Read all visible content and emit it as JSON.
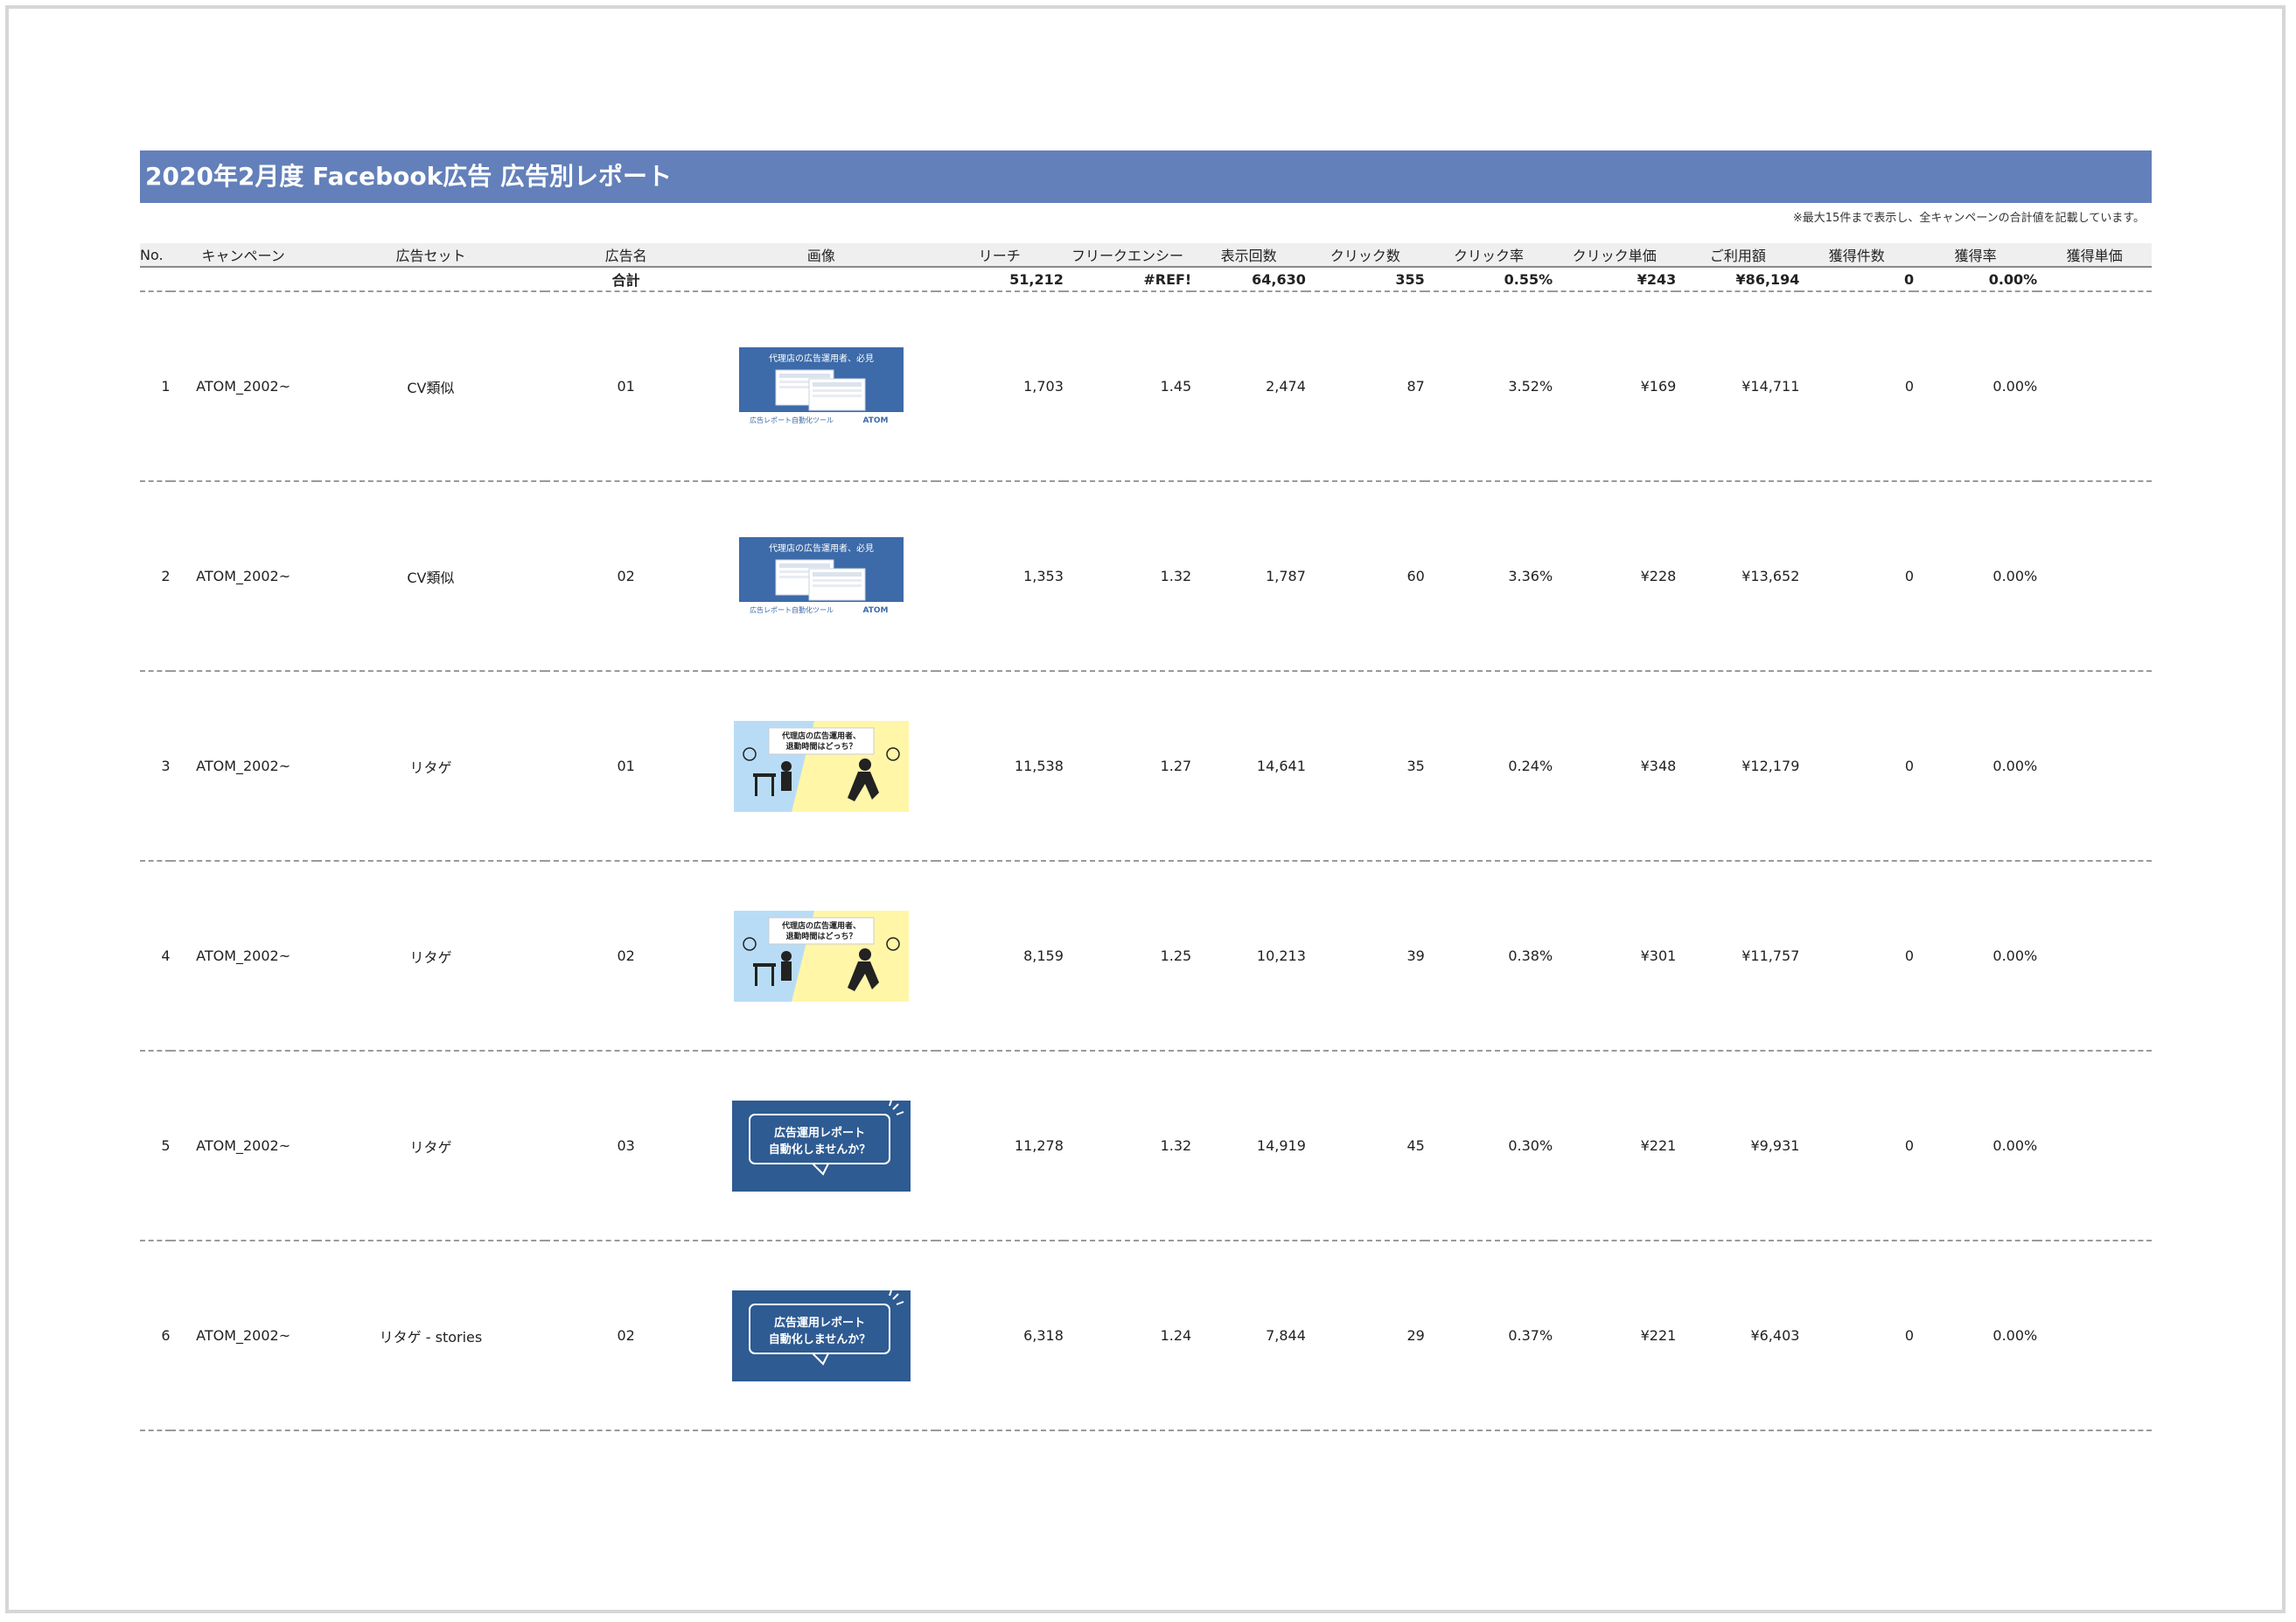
{
  "report": {
    "title": "2020年2月度 Facebook広告 広告別レポート",
    "note": "※最大15件まで表示し、全キャンペーンの合計値を記載しています。"
  },
  "columns": [
    "No.",
    "キャンペーン",
    "広告セット",
    "広告名",
    "画像",
    "リーチ",
    "フリークエンシー",
    "表示回数",
    "クリック数",
    "クリック率",
    "クリック単価",
    "ご利用額",
    "獲得件数",
    "獲得率",
    "獲得単価"
  ],
  "totals": {
    "label": "合計",
    "reach": "51,212",
    "frequency": "#REF!",
    "impressions": "64,630",
    "clicks": "355",
    "ctr": "0.55%",
    "cpc": "¥243",
    "spend": "¥86,194",
    "conversions": "0",
    "cvr": "0.00%",
    "cpa": ""
  },
  "creatives": {
    "banner_a": {
      "line1": "代理店の広告運用者、必見",
      "line2": "広告レポート自動化ツール",
      "brand": "ATOM"
    },
    "banner_b": {
      "line1": "代理店の広告運用者、",
      "line2": "退勤時間はどっち？"
    },
    "banner_c": {
      "line1": "広告運用レポート",
      "line2": "自動化しませんか？"
    }
  },
  "rows": [
    {
      "no": "1",
      "campaign": "ATOM_2002~",
      "adset": "CV類似",
      "ad": "01",
      "image": "banner-a",
      "reach": "1,703",
      "frequency": "1.45",
      "impressions": "2,474",
      "clicks": "87",
      "ctr": "3.52%",
      "cpc": "¥169",
      "spend": "¥14,711",
      "conversions": "0",
      "cvr": "0.00%",
      "cpa": ""
    },
    {
      "no": "2",
      "campaign": "ATOM_2002~",
      "adset": "CV類似",
      "ad": "02",
      "image": "banner-a",
      "reach": "1,353",
      "frequency": "1.32",
      "impressions": "1,787",
      "clicks": "60",
      "ctr": "3.36%",
      "cpc": "¥228",
      "spend": "¥13,652",
      "conversions": "0",
      "cvr": "0.00%",
      "cpa": ""
    },
    {
      "no": "3",
      "campaign": "ATOM_2002~",
      "adset": "リタゲ",
      "ad": "01",
      "image": "banner-b",
      "reach": "11,538",
      "frequency": "1.27",
      "impressions": "14,641",
      "clicks": "35",
      "ctr": "0.24%",
      "cpc": "¥348",
      "spend": "¥12,179",
      "conversions": "0",
      "cvr": "0.00%",
      "cpa": ""
    },
    {
      "no": "4",
      "campaign": "ATOM_2002~",
      "adset": "リタゲ",
      "ad": "02",
      "image": "banner-b",
      "reach": "8,159",
      "frequency": "1.25",
      "impressions": "10,213",
      "clicks": "39",
      "ctr": "0.38%",
      "cpc": "¥301",
      "spend": "¥11,757",
      "conversions": "0",
      "cvr": "0.00%",
      "cpa": ""
    },
    {
      "no": "5",
      "campaign": "ATOM_2002~",
      "adset": "リタゲ",
      "ad": "03",
      "image": "banner-c",
      "reach": "11,278",
      "frequency": "1.32",
      "impressions": "14,919",
      "clicks": "45",
      "ctr": "0.30%",
      "cpc": "¥221",
      "spend": "¥9,931",
      "conversions": "0",
      "cvr": "0.00%",
      "cpa": ""
    },
    {
      "no": "6",
      "campaign": "ATOM_2002~",
      "adset": "リタゲ - stories",
      "ad": "02",
      "image": "banner-c",
      "reach": "6,318",
      "frequency": "1.24",
      "impressions": "7,844",
      "clicks": "29",
      "ctr": "0.37%",
      "cpc": "¥221",
      "spend": "¥6,403",
      "conversions": "0",
      "cvr": "0.00%",
      "cpa": ""
    }
  ],
  "colors": {
    "title_bar": "#6380ba",
    "header_bg": "#efefef",
    "banner_a_bg": "#3d6aa8",
    "banner_b_left": "#b9dcf6",
    "banner_b_right": "#fff6a8",
    "banner_c_bg": "#2e5b92"
  }
}
